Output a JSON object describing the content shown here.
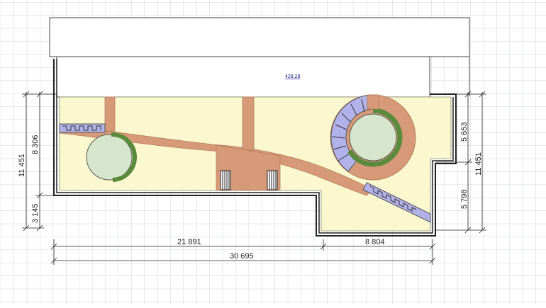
{
  "area_label": "428,28",
  "dimensions": {
    "bottom_left": "21 891",
    "bottom_right": "8 804",
    "bottom_total": "30 695",
    "left_total": "11 451",
    "left_upper": "8 306",
    "left_lower": "3 145",
    "right_upper": "5 653",
    "right_lower": "5 798",
    "right_total": "11 451"
  },
  "colors": {
    "grid": "#cfd3dc",
    "lawn": "#fbf8cf",
    "path": "#d69a78",
    "path_edge": "#b77a5a",
    "hedge": "#5a8a3c",
    "tree": "#d6e6cc",
    "paving": "#b2b2ea",
    "wall": "#222222"
  },
  "icons": [
    "tree-icon",
    "stair-icon",
    "paving-strip"
  ]
}
